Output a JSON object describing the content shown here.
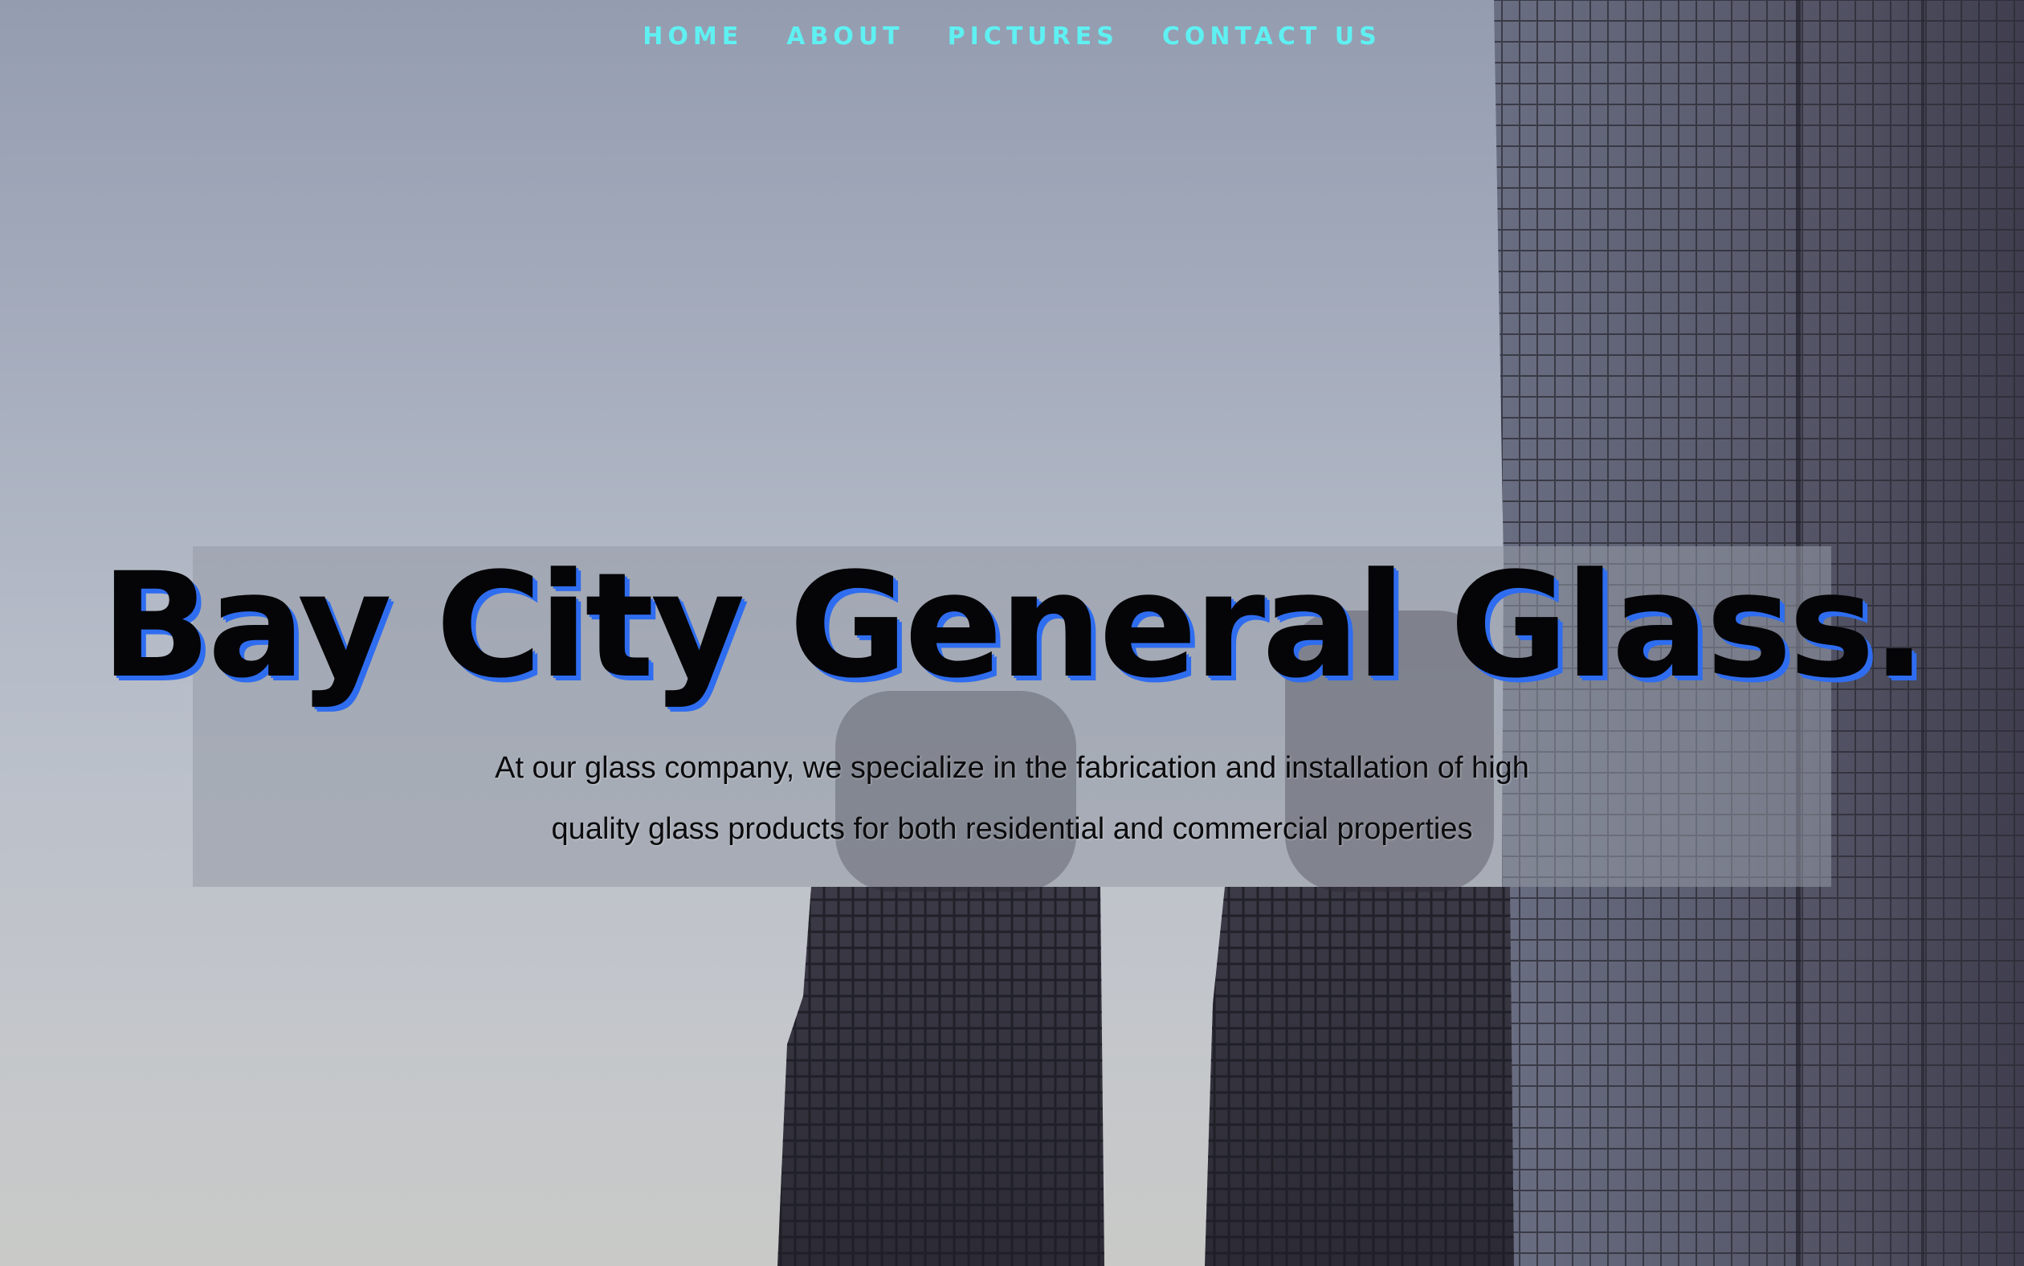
{
  "nav": {
    "items": [
      "HOME",
      "ABOUT",
      "PICTURES",
      "CONTACT US"
    ]
  },
  "hero": {
    "title": "Bay City General Glass.",
    "description": "At our glass company, we specialize in the fabrication and installation of high quality glass products for both residential and commercial properties"
  },
  "colors": {
    "nav_link": "#5ff0f2",
    "title_shadow": "#2f6df0",
    "title_text": "#050507"
  }
}
